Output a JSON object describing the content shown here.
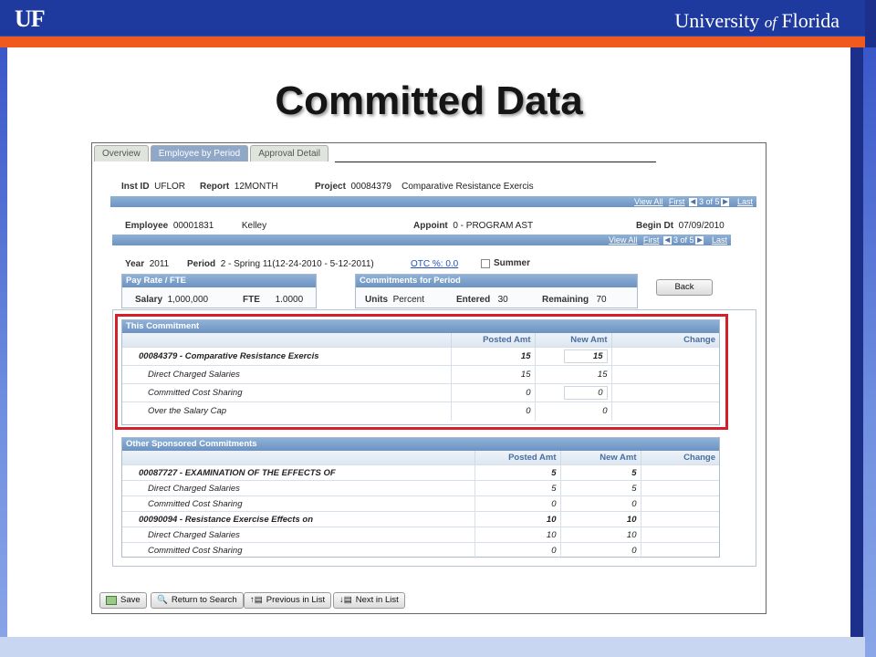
{
  "header": {
    "logo": "UF",
    "university_prefix": "University",
    "university_of": "of",
    "university_suffix": "Florida"
  },
  "slide_title": "Committed Data",
  "tabs": [
    {
      "label": "Overview"
    },
    {
      "label": "Employee by Period",
      "active": true
    },
    {
      "label": "Approval Detail"
    }
  ],
  "header_row": {
    "inst_id_label": "Inst ID",
    "inst_id": "UFLOR",
    "report_label": "Report",
    "report": "12MONTH",
    "project_label": "Project",
    "project": "00084379",
    "project_name": "Comparative Resistance Exercis"
  },
  "nav1": {
    "view_all": "View All",
    "first": "First",
    "counter": "3 of 5",
    "last": "Last"
  },
  "employee_row": {
    "employee_label": "Employee",
    "employee_id": "00001831",
    "employee_name": "Kelley",
    "appoint_label": "Appoint",
    "appoint": "0 - PROGRAM AST",
    "begin_label": "Begin Dt",
    "begin": "07/09/2010"
  },
  "nav2": {
    "view_all": "View All",
    "first": "First",
    "counter": "3 of 5",
    "last": "Last"
  },
  "period_row": {
    "year_label": "Year",
    "year": "2011",
    "period_label": "Period",
    "period": "2 - Spring 11(12-24-2010 - 5-12-2011)",
    "otc": "OTC %: 0.0",
    "summer": "Summer"
  },
  "pay_rate": {
    "title": "Pay Rate / FTE",
    "salary_label": "Salary",
    "salary": "1,000,000",
    "fte_label": "FTE",
    "fte": "1.0000"
  },
  "commitments_period": {
    "title": "Commitments for Period",
    "units_label": "Units",
    "units": "Percent",
    "entered_label": "Entered",
    "entered": "30",
    "remaining_label": "Remaining",
    "remaining": "70"
  },
  "back_button": "Back",
  "this_commitment": {
    "title": "This Commitment",
    "col_posted": "Posted Amt",
    "col_new": "New Amt",
    "col_change": "Change",
    "rows": [
      {
        "label": "00084379 - Comparative Resistance Exercis",
        "posted": "15",
        "new": "15"
      },
      {
        "label": "Direct Charged Salaries",
        "posted": "15",
        "new": "15"
      },
      {
        "label": "Committed Cost Sharing",
        "posted": "0",
        "new": "0"
      },
      {
        "label": "Over the Salary Cap",
        "posted": "0",
        "new": "0"
      }
    ]
  },
  "other_commitments": {
    "title": "Other Sponsored Commitments",
    "col_posted": "Posted Amt",
    "col_new": "New Amt",
    "col_change": "Change",
    "rows": [
      {
        "label": "00087727 - EXAMINATION OF THE EFFECTS OF",
        "posted": "5",
        "new": "5"
      },
      {
        "label": "Direct Charged Salaries",
        "posted": "5",
        "new": "5"
      },
      {
        "label": "Committed Cost Sharing",
        "posted": "0",
        "new": "0"
      },
      {
        "label": "00090094 - Resistance Exercise Effects on",
        "posted": "10",
        "new": "10"
      },
      {
        "label": "Direct Charged Salaries",
        "posted": "10",
        "new": "10"
      },
      {
        "label": "Committed Cost Sharing",
        "posted": "0",
        "new": "0"
      }
    ]
  },
  "toolbar": {
    "save": "Save",
    "return": "Return to Search",
    "previous": "Previous in List",
    "next": "Next in List"
  },
  "colors": {
    "uf_blue": "#1f3a9e",
    "uf_orange": "#f15a1f",
    "highlight_red": "#d4202a"
  }
}
